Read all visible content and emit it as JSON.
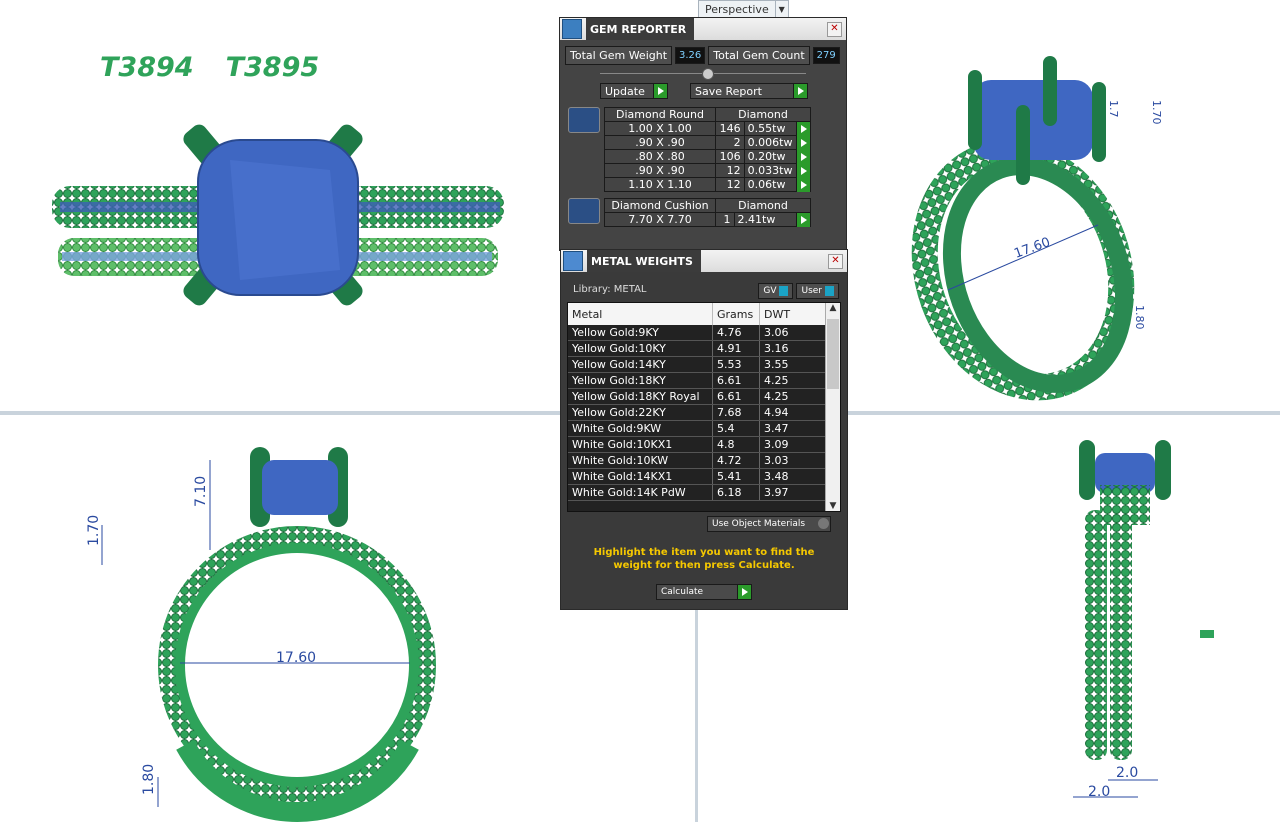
{
  "viewport": {
    "label": "Perspective"
  },
  "codes": [
    "T3894",
    "T3895"
  ],
  "dimensions": {
    "top_right": [
      "1.70",
      "1.7",
      "17.60",
      "1.80"
    ],
    "bottom_left": [
      "7.10",
      "1.70",
      "17.60",
      "1.80"
    ],
    "bottom_right": [
      "2.0",
      "2.0"
    ]
  },
  "gem_reporter": {
    "title": "GEM REPORTER",
    "total_weight_label": "Total Gem Weight",
    "total_weight": "3.26",
    "total_count_label": "Total Gem Count",
    "total_count": "279",
    "update_label": "Update",
    "save_label": "Save Report",
    "groups": [
      {
        "shape": "Diamond Round",
        "material": "Diamond",
        "rows": [
          {
            "size": "1.00 X 1.00",
            "count": "146",
            "weight": "0.55tw"
          },
          {
            "size": ".90 X .90",
            "count": "2",
            "weight": "0.006tw"
          },
          {
            "size": ".80 X .80",
            "count": "106",
            "weight": "0.20tw"
          },
          {
            "size": ".90 X .90",
            "count": "12",
            "weight": "0.033tw"
          },
          {
            "size": "1.10 X 1.10",
            "count": "12",
            "weight": "0.06tw"
          }
        ]
      },
      {
        "shape": "Diamond Cushion",
        "material": "Diamond",
        "rows": [
          {
            "size": "7.70 X 7.70",
            "count": "1",
            "weight": "2.41tw"
          }
        ]
      }
    ]
  },
  "metal_weights": {
    "title": "METAL WEIGHTS",
    "library_label": "Library: METAL",
    "gv_label": "GV",
    "user_label": "User",
    "columns": [
      "Metal",
      "Grams",
      "DWT"
    ],
    "rows": [
      [
        "Yellow Gold:9KY",
        "4.76",
        "3.06"
      ],
      [
        "Yellow Gold:10KY",
        "4.91",
        "3.16"
      ],
      [
        "Yellow Gold:14KY",
        "5.53",
        "3.55"
      ],
      [
        "Yellow Gold:18KY",
        "6.61",
        "4.25"
      ],
      [
        "Yellow Gold:18KY Royal",
        "6.61",
        "4.25"
      ],
      [
        "Yellow Gold:22KY",
        "7.68",
        "4.94"
      ],
      [
        "White Gold:9KW",
        "5.4",
        "3.47"
      ],
      [
        "White Gold:10KX1",
        "4.8",
        "3.09"
      ],
      [
        "White Gold:10KW",
        "4.72",
        "3.03"
      ],
      [
        "White Gold:14KX1",
        "5.41",
        "3.48"
      ],
      [
        "White Gold:14K PdW",
        "6.18",
        "3.97"
      ]
    ],
    "use_object_label": "Use Object Materials",
    "hint": "Highlight the item you want to find the weight for then press Calculate.",
    "calculate_label": "Calculate"
  }
}
